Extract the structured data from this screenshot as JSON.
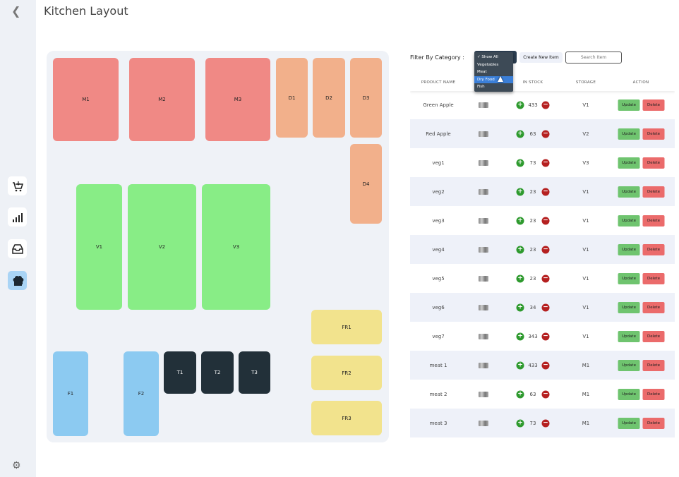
{
  "app": {
    "title": "Kitchen Layout"
  },
  "sidebar": {
    "icons": [
      "back-icon",
      "cart-icon",
      "chart-icon",
      "inbox-icon",
      "chef-hat-icon",
      "gear-icon"
    ]
  },
  "layout": {
    "zones": [
      {
        "label": "M1",
        "type": "meat"
      },
      {
        "label": "M2",
        "type": "meat"
      },
      {
        "label": "M3",
        "type": "meat"
      },
      {
        "label": "D1",
        "type": "dry"
      },
      {
        "label": "D2",
        "type": "dry"
      },
      {
        "label": "D3",
        "type": "dry"
      },
      {
        "label": "D4",
        "type": "dry"
      },
      {
        "label": "V1",
        "type": "veg"
      },
      {
        "label": "V2",
        "type": "veg"
      },
      {
        "label": "V3",
        "type": "veg"
      },
      {
        "label": "FR1",
        "type": "fridge"
      },
      {
        "label": "FR2",
        "type": "fridge"
      },
      {
        "label": "FR3",
        "type": "fridge"
      },
      {
        "label": "F1",
        "type": "fish"
      },
      {
        "label": "F2",
        "type": "fish"
      },
      {
        "label": "T1",
        "type": "table"
      },
      {
        "label": "T2",
        "type": "table"
      },
      {
        "label": "T3",
        "type": "table"
      }
    ]
  },
  "filter": {
    "label": "Filter By Category :",
    "options": [
      "✓ Show All",
      "Vegetables",
      "Meat",
      "Dry Food",
      "Fish"
    ],
    "highlighted": "Dry Food"
  },
  "toolbar": {
    "create_label": "Create New Item",
    "search_placeholder": "Search Item"
  },
  "table": {
    "columns": [
      "Product Name",
      "",
      "In Stock",
      "Storage",
      "Action"
    ],
    "update_label": "Update",
    "delete_label": "Delete",
    "rows": [
      {
        "name": "Green Apple",
        "stock": "433",
        "storage": "V1"
      },
      {
        "name": "Red Apple",
        "stock": "63",
        "storage": "V2"
      },
      {
        "name": "veg1",
        "stock": "73",
        "storage": "V3"
      },
      {
        "name": "veg2",
        "stock": "23",
        "storage": "V1"
      },
      {
        "name": "veg3",
        "stock": "23",
        "storage": "V1"
      },
      {
        "name": "veg4",
        "stock": "23",
        "storage": "V1"
      },
      {
        "name": "veg5",
        "stock": "23",
        "storage": "V1"
      },
      {
        "name": "veg6",
        "stock": "34",
        "storage": "V1"
      },
      {
        "name": "veg7",
        "stock": "343",
        "storage": "V1"
      },
      {
        "name": "meat 1",
        "stock": "433",
        "storage": "M1"
      },
      {
        "name": "meat 2",
        "stock": "63",
        "storage": "M1"
      },
      {
        "name": "meat 3",
        "stock": "73",
        "storage": "M1"
      }
    ]
  }
}
